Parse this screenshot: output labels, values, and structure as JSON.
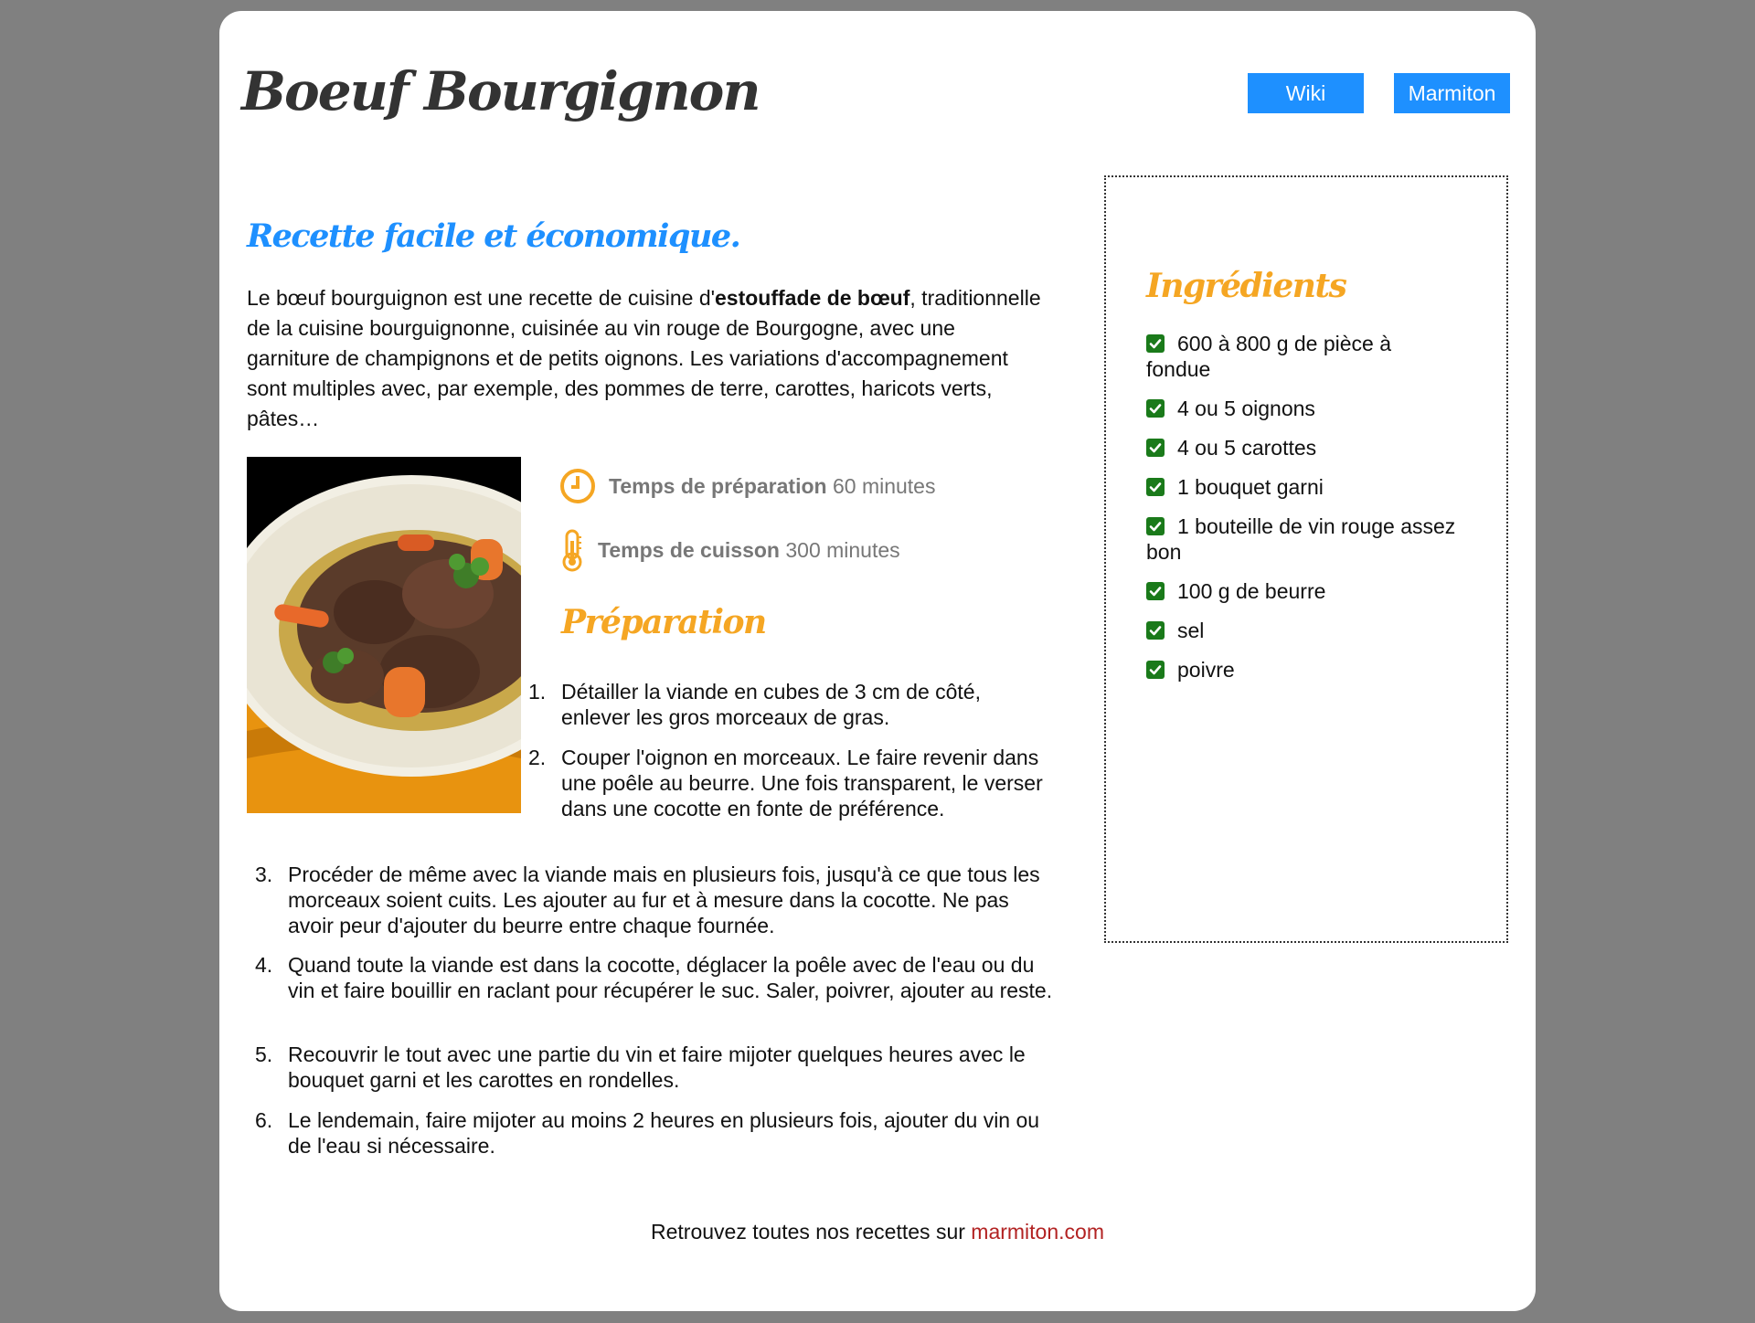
{
  "header": {
    "title": "Boeuf Bourgignon",
    "nav": [
      {
        "label": "Wiki"
      },
      {
        "label": "Marmiton"
      }
    ]
  },
  "main": {
    "subtitle": "Recette facile et économique.",
    "intro": {
      "part1": "Le bœuf bourguignon est une recette de cuisine d'",
      "bold": "estouffade de bœuf",
      "part2": ", traditionnelle de la cuisine bourguignonne, cuisinée au vin rouge de Bourgogne, avec une garniture de champignons et de petits oignons. Les variations d'accompagnement sont multiples avec, par exemple, des pommes de terre, carottes, haricots verts, pâtes…"
    },
    "times": {
      "prep_label": "Temps de préparation",
      "prep_value": "60 minutes",
      "cook_label": "Temps de cuisson",
      "cook_value": "300 minutes"
    },
    "preparation_title": "Préparation",
    "steps": [
      "Détailler la viande en cubes de 3 cm de côté, enlever les gros morceaux de gras.",
      "Couper l'oignon en morceaux. Le faire revenir dans une poêle au beurre. Une fois transparent, le verser dans une cocotte en fonte de préférence.",
      "Procéder de même avec la viande mais en plusieurs fois, jusqu'à ce que tous les morceaux soient cuits. Les ajouter au fur et à mesure dans la cocotte. Ne pas avoir peur d'ajouter du beurre entre chaque fournée.",
      "Quand toute la viande est dans la cocotte, déglacer la poêle avec de l'eau ou du vin et faire bouillir en raclant pour récupérer le suc. Saler, poivrer, ajouter au reste.",
      "Recouvrir le tout avec une partie du vin et faire mijoter quelques heures avec le bouquet garni et les carottes en rondelles.",
      "Le lendemain, faire mijoter au moins 2 heures en plusieurs fois, ajouter du vin ou de l'eau si nécessaire."
    ],
    "step_numbers": [
      "1.",
      "2.",
      "3.",
      "4.",
      "5.",
      "6."
    ]
  },
  "ingredients": {
    "title": "Ingrédients",
    "items": [
      "600 à 800 g de pièce à fondue",
      "4 ou 5 oignons",
      "4 ou 5 carottes",
      "1 bouquet garni",
      "1 bouteille de vin rouge assez bon",
      "100 g de beurre",
      "sel",
      "poivre"
    ]
  },
  "footer": {
    "text": "Retrouvez toutes nos recettes sur ",
    "link": "marmiton.com"
  },
  "colors": {
    "accent_blue": "#1e90ff",
    "accent_orange": "#f5a623",
    "check_green": "#1a7a1a",
    "link_red": "#b22222"
  },
  "icons": [
    "clock-icon",
    "thermometer-icon",
    "checkbox-checked-icon"
  ]
}
